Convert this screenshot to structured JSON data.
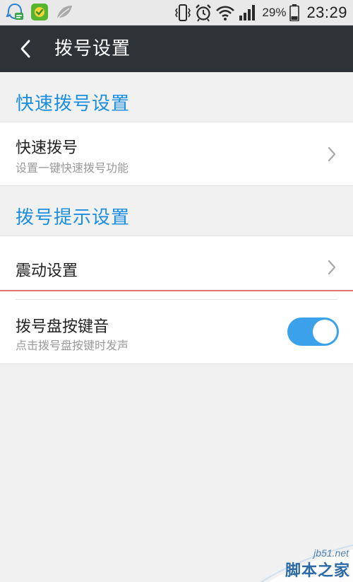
{
  "status_bar": {
    "battery_percent": "29%",
    "time": "23:29",
    "left_icons": [
      "qq-notification-icon",
      "wandoujia-app-icon",
      "leaf-app-icon"
    ],
    "right_icons": [
      "vibrate-icon",
      "alarm-icon",
      "wifi-icon",
      "signal-icon",
      "battery-icon"
    ]
  },
  "header": {
    "title": "拨号设置",
    "back_icon": "chevron-left-icon"
  },
  "sections": [
    {
      "header": "快速拨号设置",
      "rows": [
        {
          "title": "快速拨号",
          "subtitle": "设置一键快速拨号功能",
          "accessory": "chevron-right-icon"
        }
      ]
    },
    {
      "header": "拨号提示设置",
      "rows": [
        {
          "title": "震动设置",
          "accessory": "chevron-right-icon"
        },
        {
          "title": "拨号盘按键音",
          "subtitle": "点击拨号盘按键时发声",
          "accessory": "toggle",
          "toggle_on": true
        }
      ]
    }
  ],
  "colors": {
    "accent": "#1b8ee0",
    "title_bar": "#2f3338",
    "toggle_on": "#3aa1ea",
    "highlight_line": "#e57373"
  },
  "watermark": {
    "site": "jb51.net",
    "name": "脚本之家"
  }
}
